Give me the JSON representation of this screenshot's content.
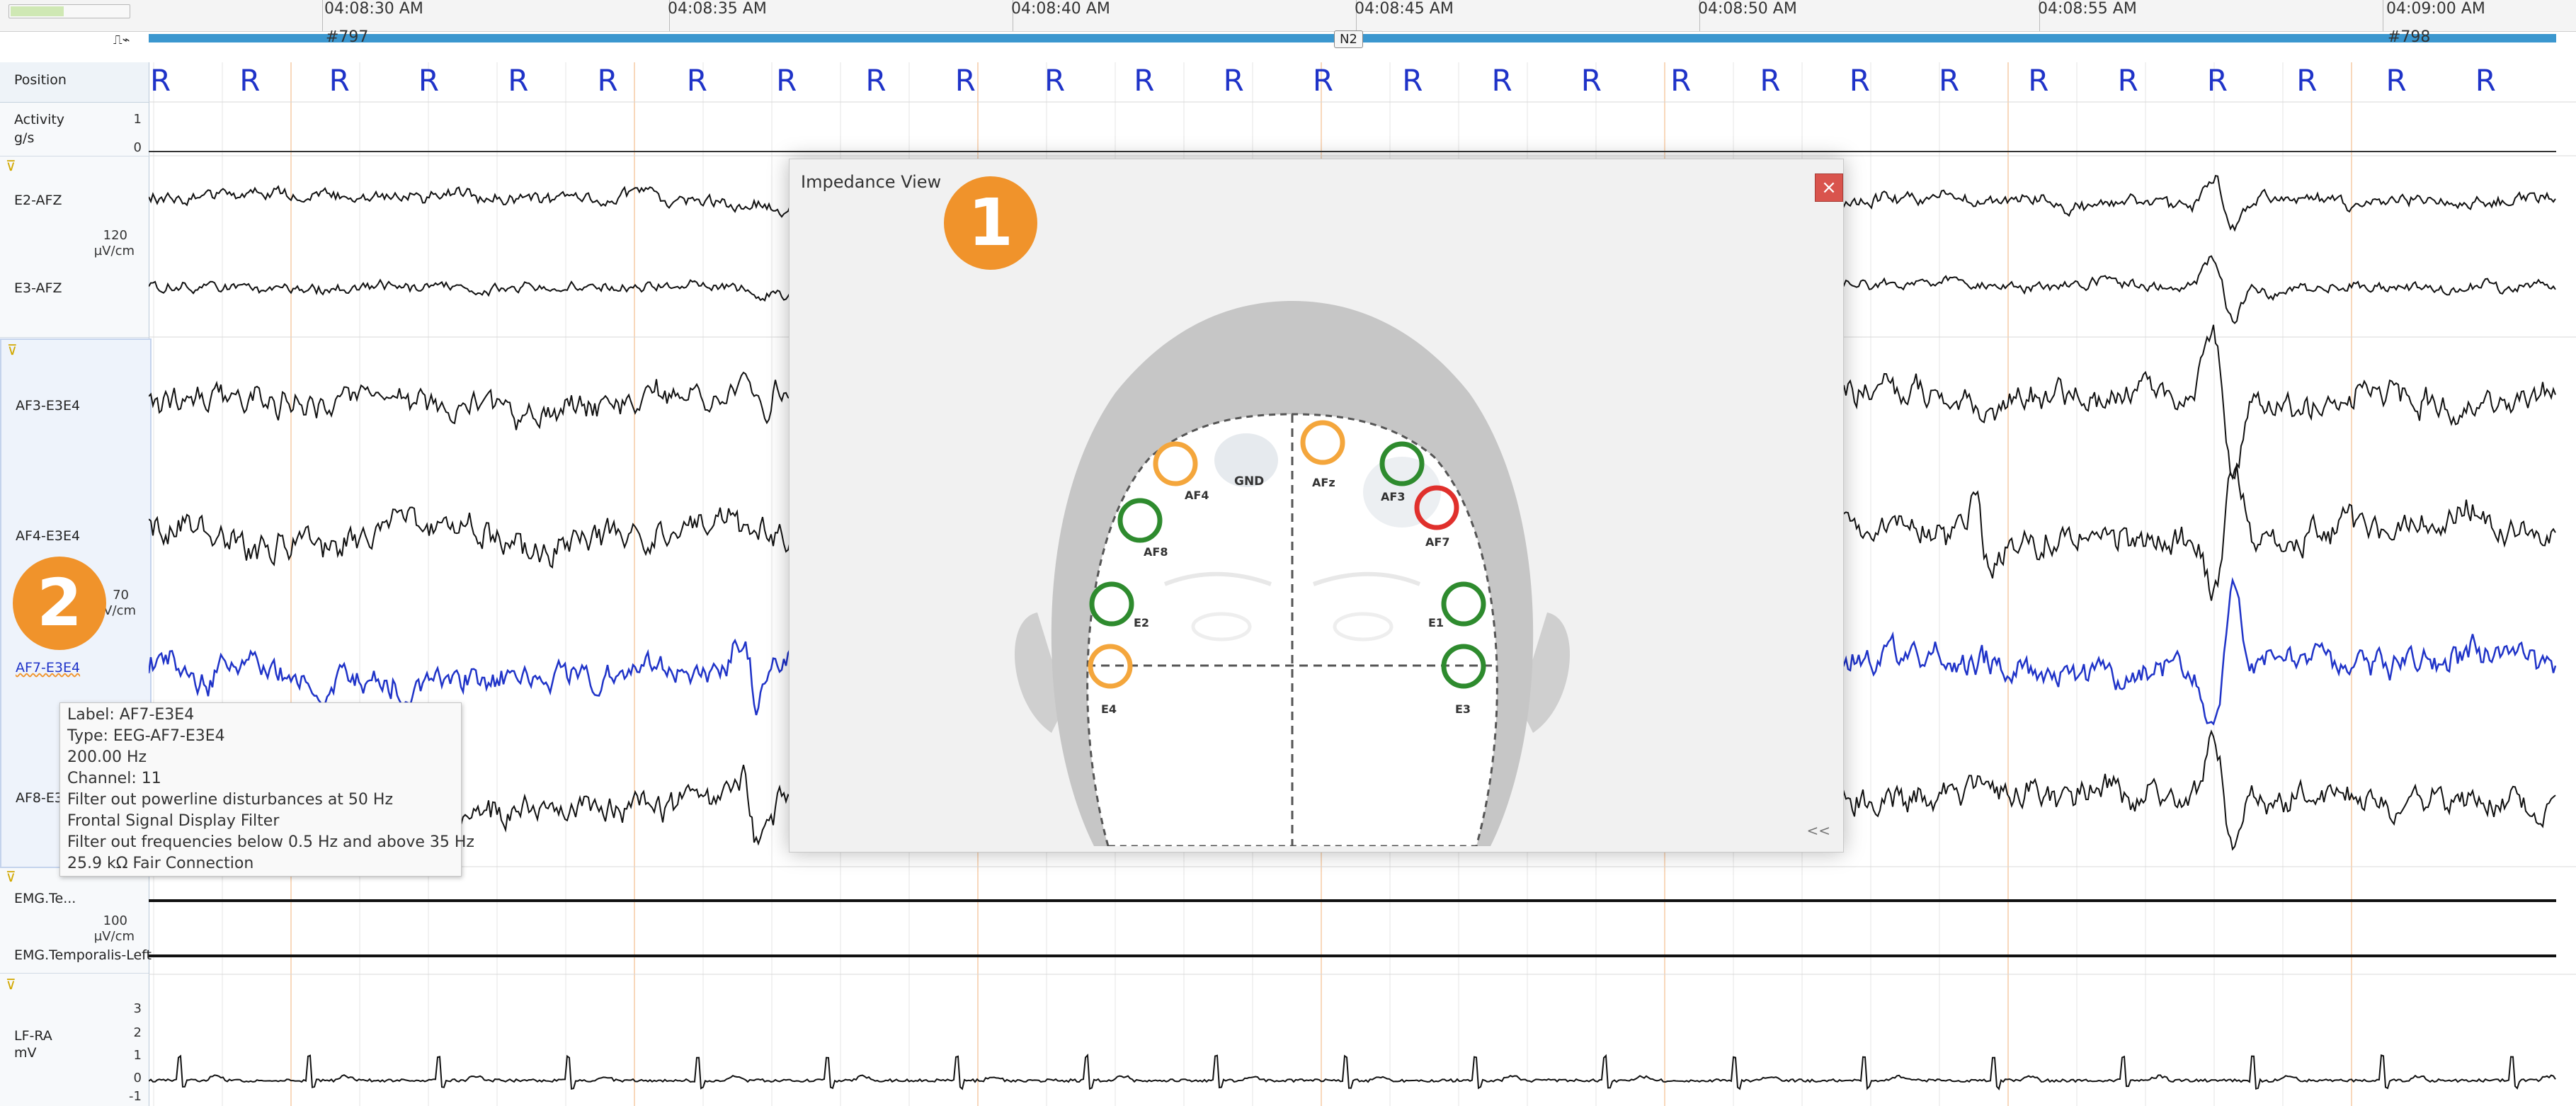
{
  "timeline": {
    "time_labels": [
      "04:08:30 AM",
      "04:08:35 AM",
      "04:08:40 AM",
      "04:08:45 AM",
      "04:08:50 AM",
      "04:08:55 AM",
      "04:09:00 AM"
    ],
    "epoch_left": "#797",
    "epoch_right": "#798",
    "stage": "N2",
    "progress": 0.45
  },
  "left_panel": {
    "position": "Position",
    "activity": "Activity",
    "activity_unit": "g/s",
    "activity_scale_top": "1",
    "activity_scale_bottom": "0",
    "eeg1_channels": [
      "E2-AFZ",
      "E3-AFZ"
    ],
    "eeg1_scale": "120",
    "eeg1_unit": "µV/cm",
    "eeg2_channels": [
      "AF3-E3E4",
      "AF4-E3E4",
      "AF7-E3E4",
      "AF8-E3E4"
    ],
    "eeg2_scale": "70",
    "eeg2_unit": "µV/cm",
    "emg_channels": [
      "EMG.Te...",
      "EMG.Temporalis-Left"
    ],
    "emg_scale": "100",
    "emg_unit": "µV/cm",
    "ecg_label": "LF-RA",
    "ecg_unit": "mV",
    "ecg_ticks": [
      "3",
      "2",
      "1",
      "0",
      "-1"
    ]
  },
  "position_marker": "R",
  "impedance_view": {
    "title": "Impedance View",
    "close": "×",
    "collapse": "<<",
    "gnd": "GND",
    "electrodes": [
      {
        "label": "AF4",
        "status": "fair",
        "color": "#f4a63c"
      },
      {
        "label": "AF8",
        "status": "good",
        "color": "#2e8b2e"
      },
      {
        "label": "AFz",
        "status": "fair",
        "color": "#f4a63c"
      },
      {
        "label": "AF3",
        "status": "good",
        "color": "#2e8b2e"
      },
      {
        "label": "AF7",
        "status": "bad",
        "color": "#e0302c"
      },
      {
        "label": "E2",
        "status": "good",
        "color": "#2e8b2e"
      },
      {
        "label": "E1",
        "status": "good",
        "color": "#2e8b2e"
      },
      {
        "label": "E4",
        "status": "fair",
        "color": "#f4a63c"
      },
      {
        "label": "E3",
        "status": "good",
        "color": "#2e8b2e"
      }
    ]
  },
  "badges": [
    "1",
    "2"
  ],
  "tooltip": {
    "lines": [
      "Label: AF7-E3E4",
      "Type: EEG-AF7-E3E4",
      "200.00 Hz",
      "Channel: 11",
      "Filter out powerline disturbances at 50 Hz",
      "Frontal Signal Display Filter",
      "Filter out frequencies below 0.5 Hz and above 35 Hz",
      "25.9 kΩ Fair Connection"
    ]
  },
  "colors": {
    "epoch_bar": "#3b97cf",
    "position_marker": "#1f33c8",
    "highlight_trace": "#1f33c8",
    "badge": "#f0932b",
    "close_button": "#d9544d"
  }
}
